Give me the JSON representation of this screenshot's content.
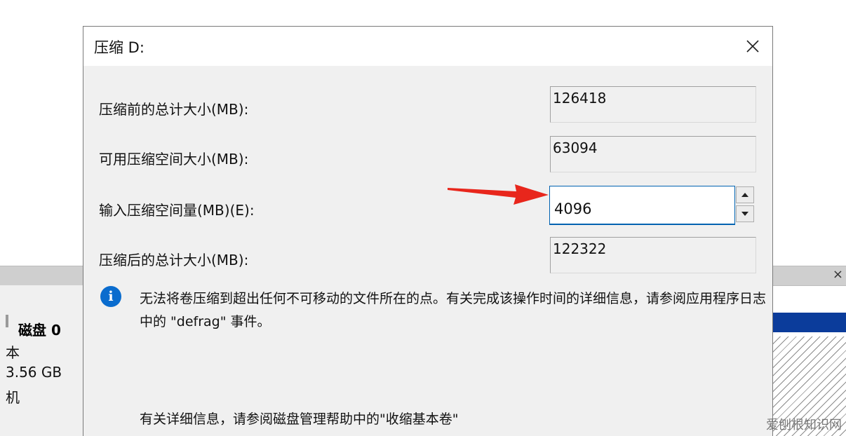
{
  "background": {
    "disk_label": "磁盘 0",
    "lines": [
      "本",
      "3.56 GB",
      "机"
    ],
    "close_glyph": "×"
  },
  "dialog": {
    "title": "压缩 D:",
    "rows": [
      {
        "label": "压缩前的总计大小(MB):",
        "value": "126418"
      },
      {
        "label": "可用压缩空间大小(MB):",
        "value": "63094"
      },
      {
        "label": "输入压缩空间量(MB)(E):",
        "value": "4096"
      },
      {
        "label": "压缩后的总计大小(MB):",
        "value": "122322"
      }
    ],
    "info_text": "无法将卷压缩到超出任何不可移动的文件所在的点。有关完成该操作时间的详细信息，请参阅应用程序日志中的 \"defrag\" 事件。",
    "help_text": "有关详细信息，请参阅磁盘管理帮助中的\"收缩基本卷\""
  },
  "watermark": "爱刨根知识网",
  "colors": {
    "accent": "#0063b1",
    "info_icon": "#0a6cce",
    "arrow": "#e8261c",
    "disk_bar": "#0b3c9b"
  },
  "icons": {
    "close": "close-icon",
    "info": "info-icon",
    "spin_up": "chevron-up-icon",
    "spin_down": "chevron-down-icon"
  }
}
